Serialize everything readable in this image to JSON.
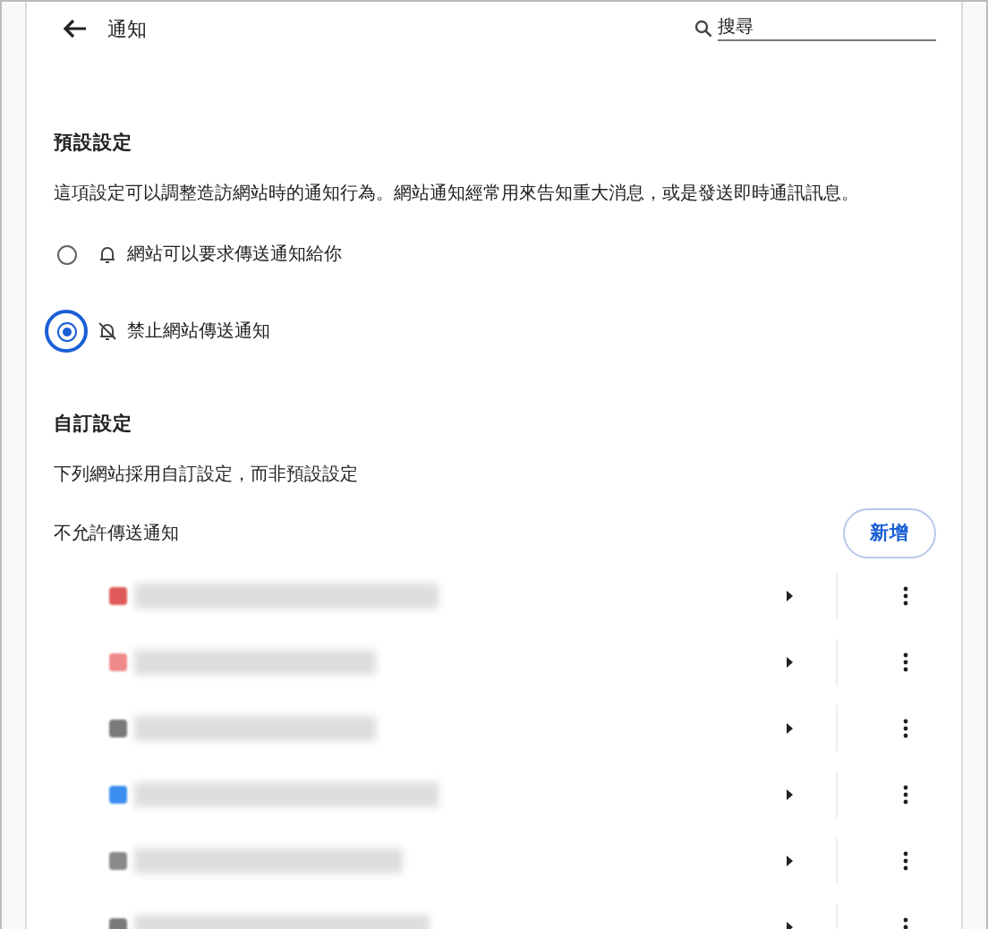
{
  "header": {
    "title": "通知",
    "search": {
      "placeholder": "搜尋"
    }
  },
  "default_settings": {
    "heading": "預設設定",
    "description": "這項設定可以調整造訪網站時的通知行為。網站通知經常用來告知重大消息，或是發送即時通訊訊息。",
    "options": [
      {
        "kind": "allow",
        "label": "網站可以要求傳送通知給你",
        "selected": false
      },
      {
        "kind": "block",
        "label": "禁止網站傳送通知",
        "selected": true
      }
    ]
  },
  "custom_settings": {
    "heading": "自訂設定",
    "description": "下列網站採用自訂設定，而非預設設定",
    "blocked_heading": "不允許傳送通知",
    "add_button": "新增",
    "sites": [
      {
        "color": "#e05a5a"
      },
      {
        "color": "#ef8a8a"
      },
      {
        "color": "#7a7a7a"
      },
      {
        "color": "#3b8ef0"
      },
      {
        "color": "#8a8a8a"
      },
      {
        "color": "#7a7a7a"
      }
    ]
  }
}
